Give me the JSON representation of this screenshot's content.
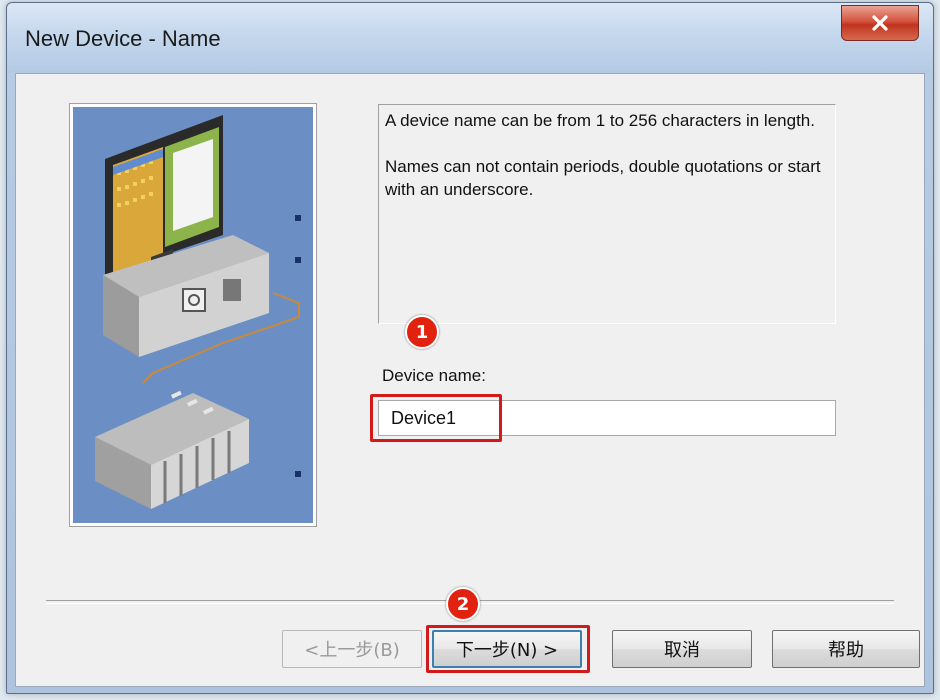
{
  "window": {
    "title": "New Device - Name",
    "close_glyph": "x"
  },
  "info": {
    "line1": "A device name can be from 1 to 256 characters in length.",
    "line2": "Names can not contain periods, double quotations or start with an underscore."
  },
  "form": {
    "label": "Device name:",
    "value": "Device1"
  },
  "markers": {
    "step1": "1",
    "step2": "2"
  },
  "buttons": {
    "back": "<上一步(B)",
    "next": "下一步(N) >",
    "cancel": "取消",
    "help": "帮助"
  },
  "colors": {
    "highlight": "#d21a1a",
    "marker": "#e0220f",
    "illustration_bg": "#6b8fc4"
  }
}
